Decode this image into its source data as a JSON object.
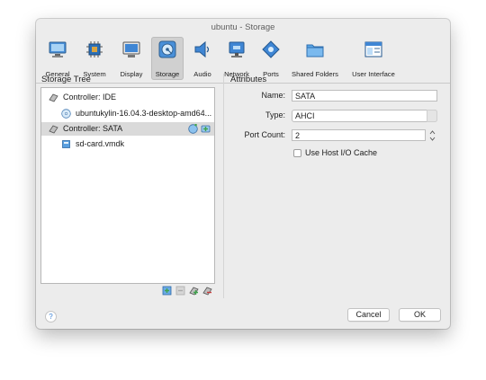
{
  "window": {
    "title": "ubuntu - Storage"
  },
  "toolbar": {
    "items": [
      {
        "label": "General",
        "icon": "monitor-icon"
      },
      {
        "label": "System",
        "icon": "chip-icon"
      },
      {
        "label": "Display",
        "icon": "display-icon"
      },
      {
        "label": "Storage",
        "icon": "storage-icon",
        "active": true
      },
      {
        "label": "Audio",
        "icon": "speaker-icon"
      },
      {
        "label": "Network",
        "icon": "network-icon"
      },
      {
        "label": "Ports",
        "icon": "ports-icon"
      },
      {
        "label": "Shared Folders",
        "icon": "folder-icon"
      },
      {
        "label": "User Interface",
        "icon": "window-icon"
      }
    ]
  },
  "storage_tree": {
    "title": "Storage Tree",
    "items": [
      {
        "label": "Controller: IDE",
        "icon": "ide-controller-icon",
        "selected": false
      },
      {
        "label": "ubuntukylin-16.04.3-desktop-amd64...",
        "icon": "optical-disc-icon",
        "selected": false
      },
      {
        "label": "Controller: SATA",
        "icon": "sata-controller-icon",
        "selected": true
      },
      {
        "label": "sd-card.vmdk",
        "icon": "hard-disk-icon",
        "selected": false
      }
    ]
  },
  "attributes": {
    "title": "Attributes",
    "name_label": "Name:",
    "name_value": "SATA",
    "type_label": "Type:",
    "type_value": "AHCI",
    "port_count_label": "Port Count:",
    "port_count_value": "2",
    "host_io_cache_label": "Use Host I/O Cache",
    "host_io_cache_checked": false
  },
  "footer": {
    "help_label": "?",
    "cancel_label": "Cancel",
    "ok_label": "OK"
  },
  "colors": {
    "window_bg": "#ececec",
    "selection": "#dadada",
    "accent_blue": "#3b82d6",
    "accent_green": "#3fa34d"
  }
}
